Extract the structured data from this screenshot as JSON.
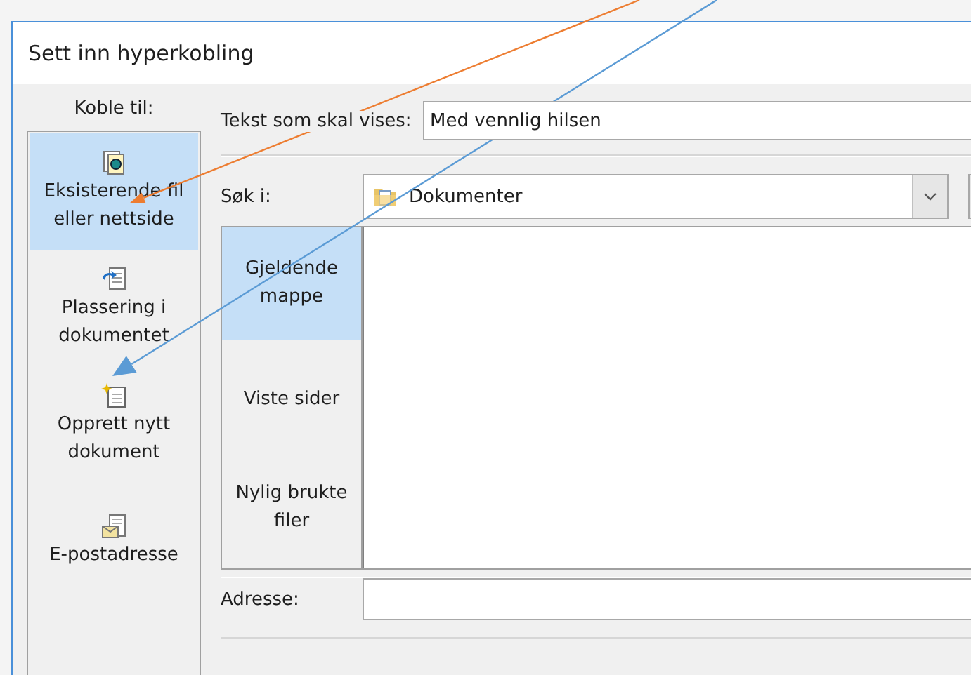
{
  "window": {
    "title": "Sett inn hyperkobling"
  },
  "sidebar": {
    "label": "Koble til:",
    "items": [
      {
        "label": "Eksisterende fil eller nettside",
        "kind": "web-file",
        "selected": true
      },
      {
        "label": "Plassering i dokumentet",
        "kind": "place",
        "selected": false
      },
      {
        "label": "Opprett nytt dokument",
        "kind": "new-doc",
        "selected": false
      },
      {
        "label": "E-postadresse",
        "kind": "mail",
        "selected": false
      }
    ]
  },
  "display_text": {
    "label": "Tekst som skal vises:",
    "value": "Med vennlig hilsen"
  },
  "look_in": {
    "label": "Søk i:",
    "value": "Dokumenter"
  },
  "tabs": [
    {
      "label": "Gjeldende mappe",
      "selected": true
    },
    {
      "label": "Viste sider",
      "selected": false
    },
    {
      "label": "Nylig brukte filer",
      "selected": false
    }
  ],
  "address": {
    "label": "Adresse:"
  },
  "annotations": [
    {
      "color": "#ed7d31"
    },
    {
      "color": "#5b9bd5"
    }
  ]
}
